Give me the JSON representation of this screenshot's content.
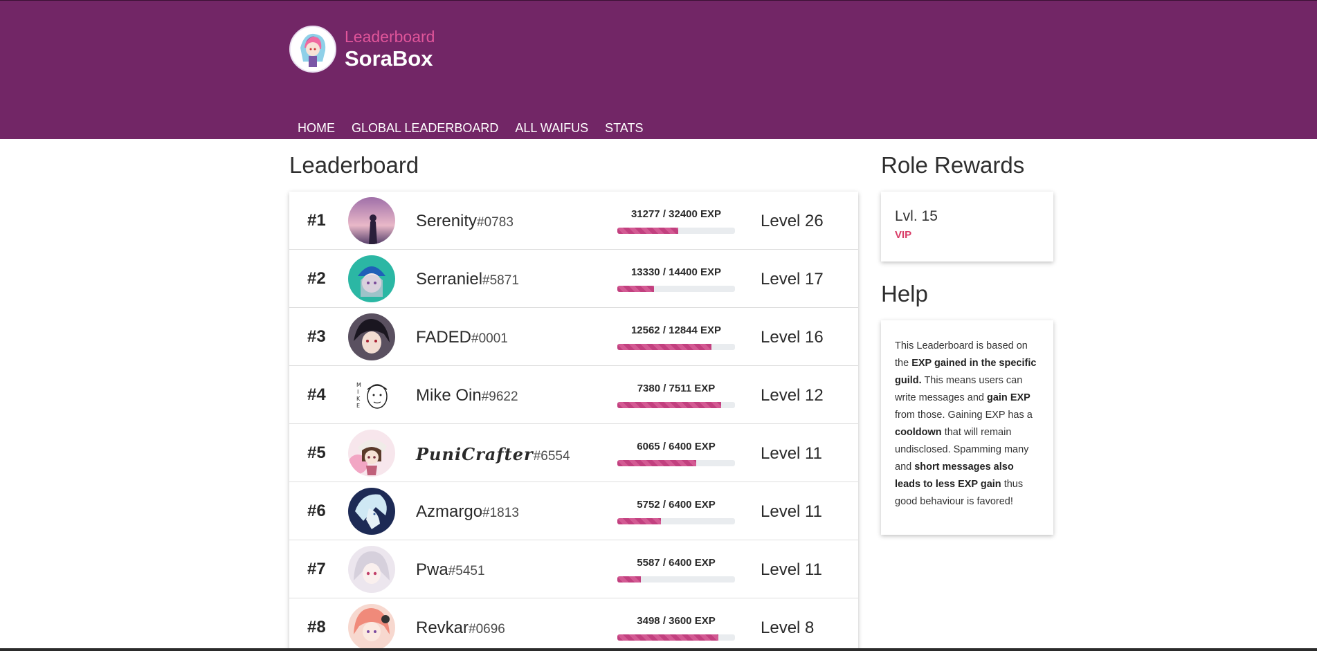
{
  "brand": {
    "subtitle": "Leaderboard",
    "title": "SoraBox"
  },
  "nav": [
    {
      "label": "HOME"
    },
    {
      "label": "GLOBAL LEADERBOARD"
    },
    {
      "label": "ALL WAIFUS"
    },
    {
      "label": "STATS"
    }
  ],
  "leaderboard": {
    "title": "Leaderboard",
    "rows": [
      {
        "rank": "#1",
        "name": "Serenity",
        "disc": "#0783",
        "exp": "31277 / 32400",
        "exp_unit": "EXP",
        "progress": 0.52,
        "level": "Level 26",
        "avatar_color": "#b58fb8"
      },
      {
        "rank": "#2",
        "name": "Serraniel",
        "disc": "#5871",
        "exp": "13330 / 14400",
        "exp_unit": "EXP",
        "progress": 0.31,
        "level": "Level 17",
        "avatar_color": "#2bb7a4"
      },
      {
        "rank": "#3",
        "name": "FADED",
        "disc": "#0001",
        "exp": "12562 / 12844",
        "exp_unit": "EXP",
        "progress": 0.8,
        "level": "Level 16",
        "avatar_color": "#3a3340"
      },
      {
        "rank": "#4",
        "name": "Mike Oin",
        "disc": "#9622",
        "exp": "7380 / 7511",
        "exp_unit": "EXP",
        "progress": 0.88,
        "level": "Level 12",
        "avatar_color": "#ffffff"
      },
      {
        "rank": "#5",
        "name": "PuniCrafter",
        "disc": "#6554",
        "exp": "6065 / 6400",
        "exp_unit": "EXP",
        "progress": 0.67,
        "level": "Level 11",
        "avatar_color": "#f1c6d4"
      },
      {
        "rank": "#6",
        "name": "Azmargo",
        "disc": "#1813",
        "exp": "5752 / 6400",
        "exp_unit": "EXP",
        "progress": 0.37,
        "level": "Level 11",
        "avatar_color": "#1d2a55"
      },
      {
        "rank": "#7",
        "name": "Pwa",
        "disc": "#5451",
        "exp": "5587 / 6400",
        "exp_unit": "EXP",
        "progress": 0.2,
        "level": "Level 11",
        "avatar_color": "#d7cfd9"
      },
      {
        "rank": "#8",
        "name": "Revkar",
        "disc": "#0696",
        "exp": "3498 / 3600",
        "exp_unit": "EXP",
        "progress": 0.86,
        "level": "Level 8",
        "avatar_color": "#f2a08c"
      }
    ]
  },
  "role_rewards": {
    "title": "Role Rewards",
    "level": "Lvl. 15",
    "role": "VIP"
  },
  "help": {
    "title": "Help",
    "t1": "This Leaderboard is based on the ",
    "b1": "EXP gained in the specific guild.",
    "t2": " This means users can write messages and ",
    "b2": "gain EXP",
    "t3": " from those. Gaining EXP has a ",
    "b3": "cooldown",
    "t4": " that will remain undisclosed. Spamming many and ",
    "b4": "short messages also leads to less EXP gain",
    "t5": " thus good behaviour is favored!"
  },
  "colors": {
    "header": "#722666",
    "accent": "#e0559a",
    "progress": "#c2407f",
    "vip": "#d93b66"
  }
}
